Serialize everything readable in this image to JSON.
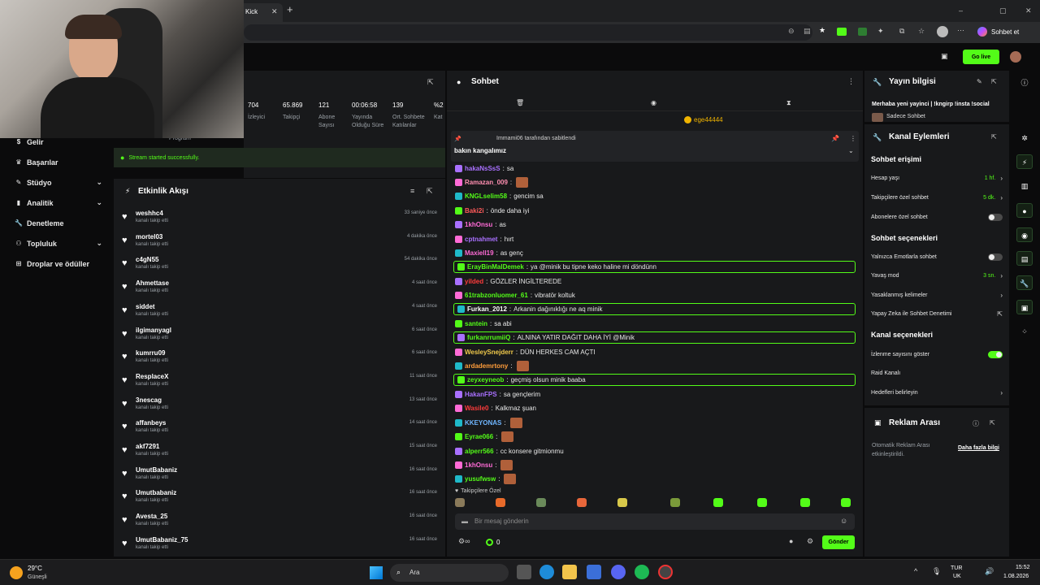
{
  "browser": {
    "tab_title": "Kick",
    "new_tab": "+",
    "window_controls": [
      "–",
      "▢",
      "✕"
    ],
    "sohbet_et": "Sohbet et"
  },
  "header": {
    "go_live": "Go live"
  },
  "nav": {
    "items": [
      {
        "label": "Gelir",
        "icon": "dollar-icon",
        "chev": false
      },
      {
        "label": "Başarılar",
        "icon": "trophy-icon",
        "chev": false
      },
      {
        "label": "Stüdyo",
        "icon": "brush-icon",
        "chev": true
      },
      {
        "label": "Analitik",
        "icon": "chart-icon",
        "chev": true
      },
      {
        "label": "Denetleme",
        "icon": "wrench-icon",
        "chev": false
      },
      {
        "label": "Topluluk",
        "icon": "people-icon",
        "chev": true
      },
      {
        "label": "Droplar ve ödüller",
        "icon": "gift-icon",
        "chev": false
      }
    ]
  },
  "stats": {
    "program_label": "Program",
    "items": [
      {
        "value": "704",
        "label": "İzleyici"
      },
      {
        "value": "65.869",
        "label": "Takipçi"
      },
      {
        "value": "121",
        "label": "Abone Sayısı"
      },
      {
        "value": "00:06:58",
        "label": "Yayında Olduğu Süre"
      },
      {
        "value": "139",
        "label": "Ort. Sohbete Katılanlar"
      },
      {
        "value": "%2",
        "label": "Kat"
      }
    ],
    "success_msg": "Stream started successfully."
  },
  "activity": {
    "title": "Etkinlik Akışı",
    "rows": [
      {
        "user": "weshhc4",
        "sub": "kanalı takip etti",
        "time": "33 saniye önce"
      },
      {
        "user": "mortel03",
        "sub": "kanalı takip etti",
        "time": "4 dakika önce"
      },
      {
        "user": "c4gN55",
        "sub": "kanalı takip etti",
        "time": "54 dakika önce"
      },
      {
        "user": "Ahmettase",
        "sub": "kanalı takip etti",
        "time": "4 saat önce"
      },
      {
        "user": "siddet",
        "sub": "kanalı takip etti",
        "time": "4 saat önce"
      },
      {
        "user": "ilgimanyagl",
        "sub": "kanalı takip etti",
        "time": "6 saat önce"
      },
      {
        "user": "kumrru09",
        "sub": "kanalı takip etti",
        "time": "6 saat önce"
      },
      {
        "user": "ResplaceX",
        "sub": "kanalı takip etti",
        "time": "11 saat önce"
      },
      {
        "user": "3nescag",
        "sub": "kanalı takip etti",
        "time": "13 saat önce"
      },
      {
        "user": "affanbeys",
        "sub": "kanalı takip etti",
        "time": "14 saat önce"
      },
      {
        "user": "akf7291",
        "sub": "kanalı takip etti",
        "time": "15 saat önce"
      },
      {
        "user": "UmutBabaniz",
        "sub": "kanalı takip etti",
        "time": "16 saat önce"
      },
      {
        "user": "Umutbabaniz",
        "sub": "kanalı takip etti",
        "time": "16 saat önce"
      },
      {
        "user": "Avesta_25",
        "sub": "kanalı takip etti",
        "time": "16 saat önce"
      },
      {
        "user": "UmutBabaniz_75",
        "sub": "kanalı takip etti",
        "time": "16 saat önce"
      }
    ]
  },
  "chat": {
    "title": "Sohbet",
    "top_gifter": "ege44444",
    "pinned_by": "Immami06 tarafından sabitlendi",
    "pinned_text": "bakın kangalımız",
    "messages": [
      {
        "name": "hakaNsSsS",
        "color": "#a970ff",
        "text": "sa",
        "hl": false,
        "emote": false
      },
      {
        "name": "Ramazan_009",
        "color": "#ff8fb1",
        "text": "",
        "hl": false,
        "emote": true
      },
      {
        "name": "KNGLselim58",
        "color": "#53fc18",
        "text": "gencim sa",
        "hl": false,
        "emote": false
      },
      {
        "name": "Baki2i",
        "color": "#ff5a5a",
        "text": "önde daha iyi",
        "hl": false,
        "emote": false
      },
      {
        "name": "1khOnsu",
        "color": "#ff6bd6",
        "text": "as",
        "hl": false,
        "emote": false
      },
      {
        "name": "cptnahmet",
        "color": "#a970ff",
        "text": "hırt",
        "hl": false,
        "emote": false
      },
      {
        "name": "Maxiell19",
        "color": "#ff6bd6",
        "text": "as genç",
        "hl": false,
        "emote": false
      },
      {
        "name": "ErayBinMalDemek",
        "color": "#53fc18",
        "text": "ya @minik bu tipne keko haline mi döndünn",
        "hl": true,
        "emote": false
      },
      {
        "name": "yilded",
        "color": "#ff3b3b",
        "text": "GÖZLER İNGİLTEREDE",
        "hl": false,
        "emote": false
      },
      {
        "name": "61trabzonluomer_61",
        "color": "#53fc18",
        "text": "vibratör koltuk",
        "hl": false,
        "emote": false
      },
      {
        "name": "Furkan_2012",
        "color": "#ffffff",
        "text": "Arkanin dağınıklığı ne aq minik",
        "hl": true,
        "emote": false
      },
      {
        "name": "santein",
        "color": "#53fc18",
        "text": "sa abi",
        "hl": false,
        "emote": false
      },
      {
        "name": "furkanrrumiiQ",
        "color": "#53fc18",
        "text": "ALNINA YATIR DAĞIT DAHA İYİ @Minik",
        "hl": true,
        "emote": false
      },
      {
        "name": "WesleySnejderr",
        "color": "#f0c94b",
        "text": "DÜN HERKES CAM AÇTI",
        "hl": false,
        "emote": false
      },
      {
        "name": "ardademrtony",
        "color": "#ff9d3b",
        "text": "",
        "hl": false,
        "emote": true
      },
      {
        "name": "zeyxeyneob",
        "color": "#53fc18",
        "text": "geçmiş olsun minik baaba",
        "hl": true,
        "emote": false
      },
      {
        "name": "HakanFPS",
        "color": "#a970ff",
        "text": "sa gençlerim",
        "hl": false,
        "emote": false
      },
      {
        "name": "Wasile0",
        "color": "#ff3b3b",
        "text": "Kalkmaz şuan",
        "hl": false,
        "emote": false
      },
      {
        "name": "KKEYONAS",
        "color": "#6fb6ff",
        "text": "",
        "hl": false,
        "emote": true
      },
      {
        "name": "Eyrae066",
        "color": "#53fc18",
        "text": "",
        "hl": false,
        "emote": true
      },
      {
        "name": "alperr566",
        "color": "#53fc18",
        "text": "cc konsere gitmionmu",
        "hl": false,
        "emote": false
      },
      {
        "name": "1khOnsu",
        "color": "#ff6bd6",
        "text": "",
        "hl": false,
        "emote": true
      },
      {
        "name": "yusufwsw",
        "color": "#53fc18",
        "text": "",
        "hl": false,
        "emote": true
      }
    ],
    "followers_only": "Takipçilere Özel",
    "input_placeholder": "Bir mesaj gönderin",
    "points": "0",
    "send": "Gönder"
  },
  "stream_info": {
    "title": "Yayın bilgisi",
    "stream_title": "Merhaba yeni yayinci | !kngirp !insta !social",
    "category": "Sadece Sohbet"
  },
  "channel_actions": {
    "title": "Kanal Eylemleri",
    "chat_access": "Sohbet erişimi",
    "account_age": {
      "label": "Hesap yaşı",
      "value": "1 hf."
    },
    "followers_chat": {
      "label": "Takipçilere özel sohbet",
      "value": "5 dk."
    },
    "subs_chat": "Abonelere özel sohbet",
    "chat_options": "Sohbet seçenekleri",
    "emotes_only": "Yalnızca Emotlarla sohbet",
    "slow_mode": {
      "label": "Yavaş mod",
      "value": "3 sn."
    },
    "banned_words": "Yasaklanmış kelimeler",
    "ai_moderation": "Yapay Zeka ile Sohbet Denetimi",
    "channel_options": "Kanal seçenekleri",
    "show_viewers": "İzlenme sayısını göster",
    "raid": "Raid Kanalı",
    "goals": "Hedefleri belirleyin"
  },
  "ad_break": {
    "title": "Reklam Arası",
    "desc": "Otomatik Reklam Arası etkinleştirildi.",
    "link": "Daha fazla bilgi"
  },
  "taskbar": {
    "weather_temp": "29°C",
    "weather_desc": "Güneşli",
    "search": "Ara",
    "lang_top": "TUR",
    "lang_bottom": "UK",
    "time": "15:52",
    "date": "1.08.2026"
  },
  "colors": {
    "accent": "#53fc18",
    "panel": "#18191b",
    "bg": "#0b0b0c"
  }
}
